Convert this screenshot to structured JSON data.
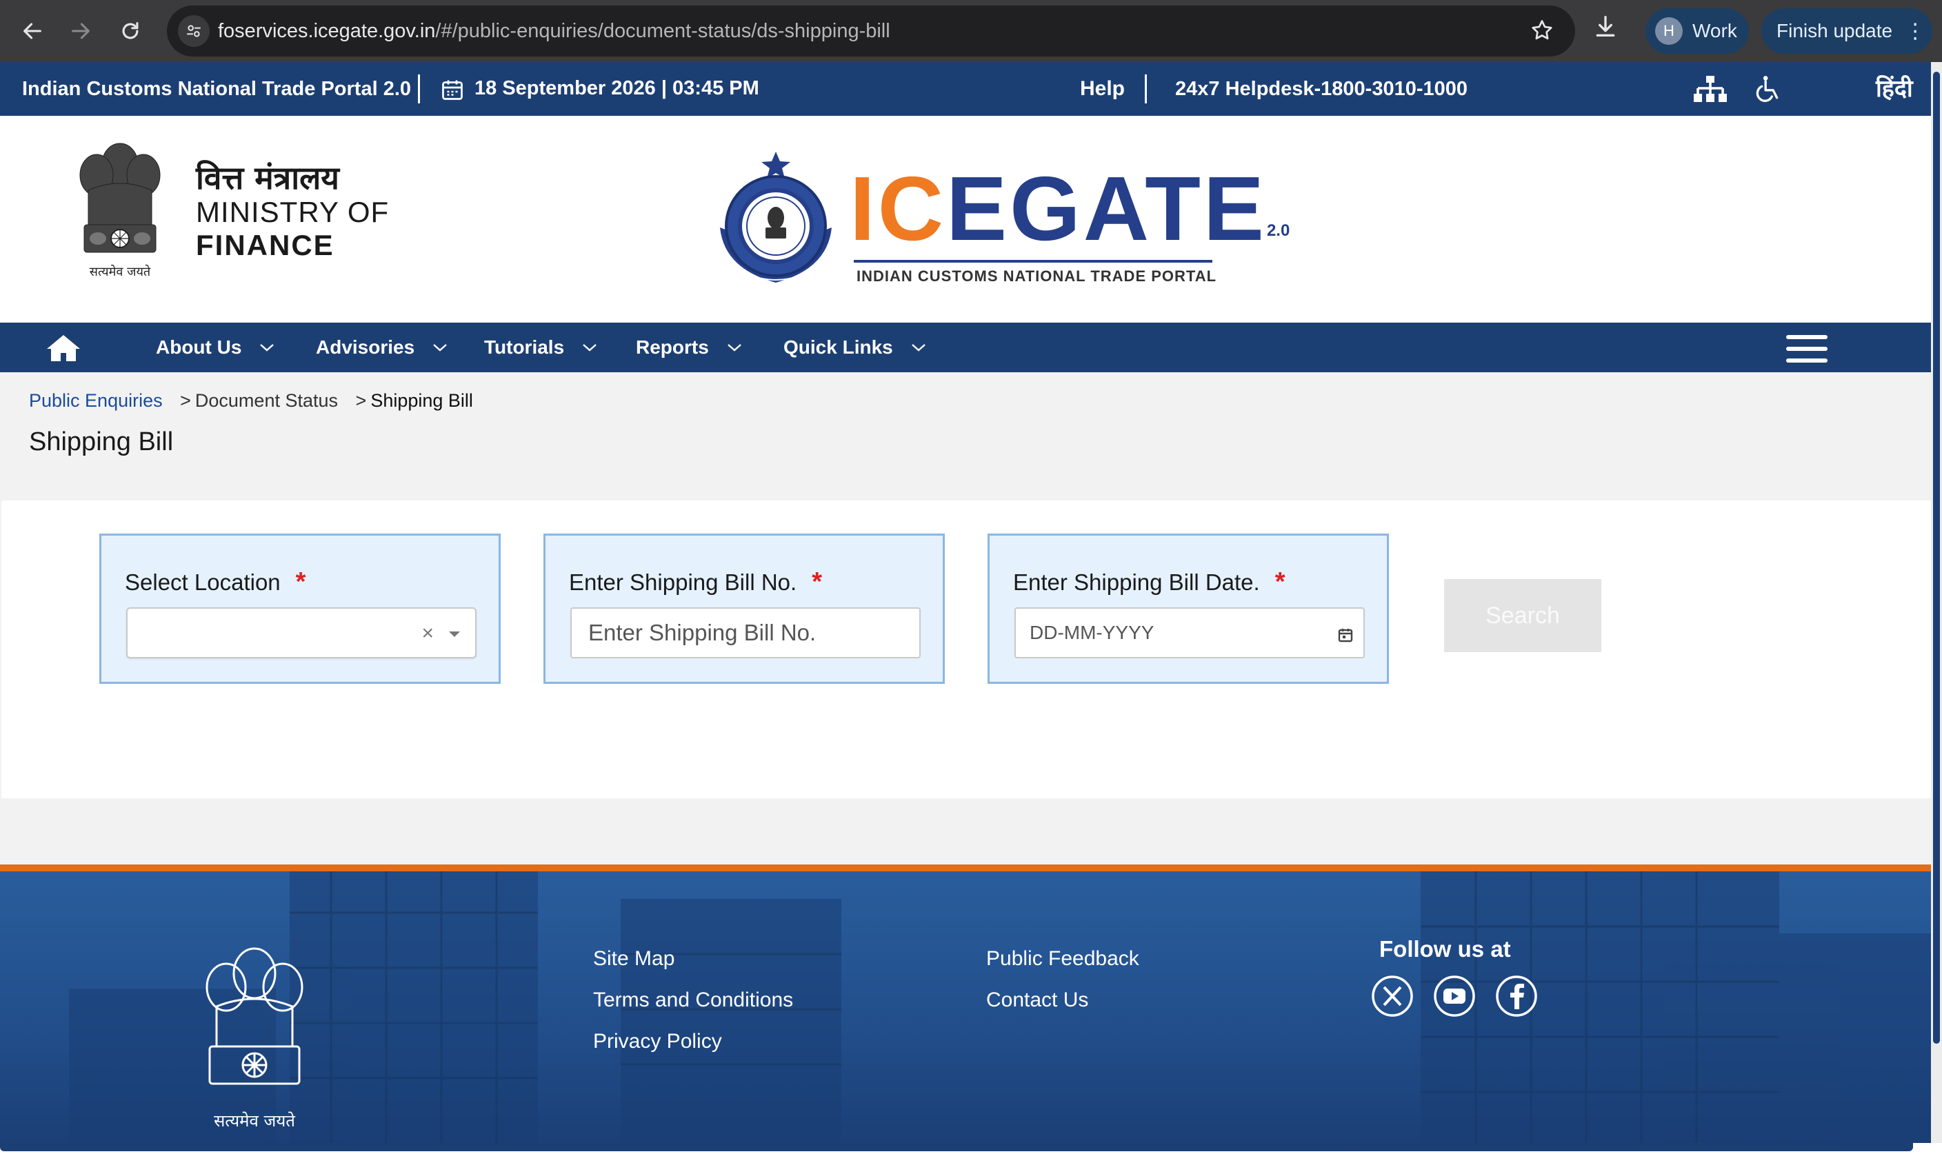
{
  "browser": {
    "url_host": "foservices.icegate.gov.in",
    "url_path": "/#/public-enquiries/document-status/ds-shipping-bill",
    "profile_initial": "H",
    "profile_label": "Work",
    "update_label": "Finish update",
    "kebab": "⋮"
  },
  "topbar": {
    "portal_name": "Indian Customs National Trade Portal 2.0",
    "date": "18 September 2026",
    "time_sep": "|",
    "time": "03:45 PM",
    "help": "Help",
    "helpdesk": "24x7 Helpdesk-1800-3010-1000",
    "language": "हिंदी"
  },
  "header": {
    "ministry_hindi": "वित्त मंत्रालय",
    "ministry_line1": "MINISTRY OF",
    "ministry_line2": "FINANCE",
    "emblem_motto": "सत्यमेव जयते",
    "logo_ic": "IC",
    "logo_e": "E",
    "logo_gate": "GATE",
    "logo_version": "2.0",
    "logo_tagline": "INDIAN CUSTOMS NATIONAL TRADE PORTAL"
  },
  "nav": {
    "items": [
      {
        "label": "About Us"
      },
      {
        "label": "Advisories"
      },
      {
        "label": "Tutorials"
      },
      {
        "label": "Reports"
      },
      {
        "label": "Quick Links"
      }
    ]
  },
  "breadcrumb": {
    "root": "Public Enquiries",
    "sep": ">",
    "middle": "Document Status",
    "current": "Shipping Bill"
  },
  "page_title": "Shipping Bill",
  "form": {
    "location": {
      "label": "Select Location",
      "required": "*",
      "value": "",
      "clear": "×"
    },
    "bill_no": {
      "label": "Enter Shipping Bill No.",
      "required": "*",
      "placeholder": "Enter Shipping Bill No.",
      "value": ""
    },
    "bill_date": {
      "label": "Enter Shipping Bill Date.",
      "required": "*",
      "placeholder": "DD-MM-YYYY",
      "value": ""
    },
    "search_label": "Search"
  },
  "footer": {
    "links_col1": [
      "Site Map",
      "Terms and Conditions",
      "Privacy Policy"
    ],
    "links_col2": [
      "Public Feedback",
      "Contact Us"
    ],
    "follow_label": "Follow us at",
    "social": [
      "x-icon",
      "youtube-icon",
      "facebook-icon"
    ],
    "emblem_motto": "सत्यमेव जयते"
  },
  "colors": {
    "navy": "#1c3f73",
    "accent_orange": "#e56d16",
    "card_bg": "#e5f1fd",
    "card_border": "#8cb6e3",
    "required_red": "#e02020",
    "link_blue": "#1b4b9a"
  }
}
